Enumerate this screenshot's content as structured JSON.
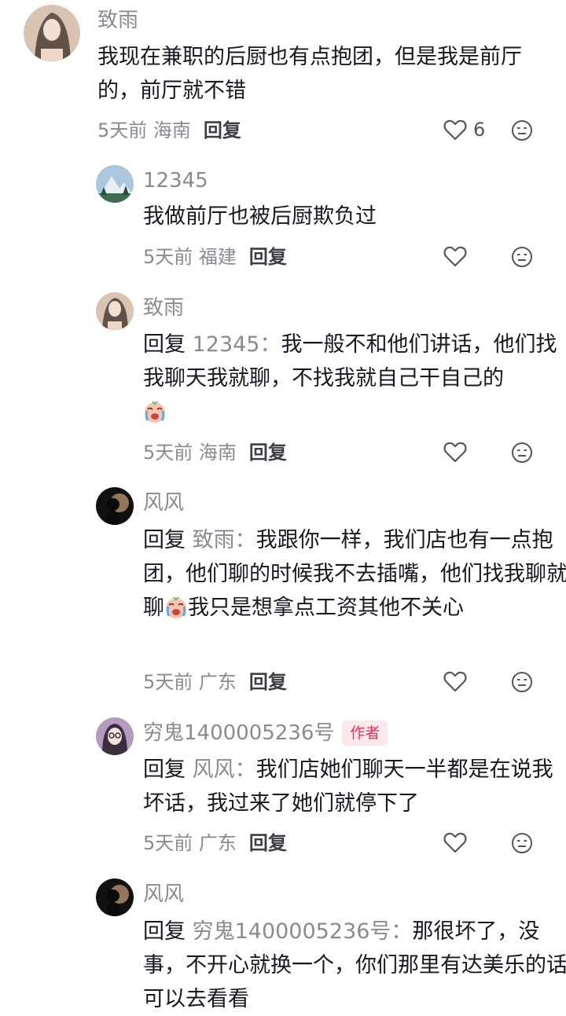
{
  "comments": [
    {
      "user": "致雨",
      "text": "我现在兼职的后厨也有点抱团，但是我是前厅的，前厅就不错",
      "time": "5天前",
      "location": "海南",
      "reply_label": "回复",
      "likes": "6"
    },
    {
      "user": "12345",
      "text": "我做前厅也被后厨欺负过",
      "time": "5天前",
      "location": "福建",
      "reply_label": "回复"
    },
    {
      "user": "致雨",
      "reply_prefix": "回复",
      "reply_target": "12345：",
      "text": "我一般不和他们讲话，他们找我聊天我就聊，不找我就自己干自己的",
      "emoji": "crying-laugh-emoji",
      "time": "5天前",
      "location": "海南",
      "reply_label": "回复"
    },
    {
      "user": "风风",
      "reply_prefix": "回复",
      "reply_target": "致雨：",
      "text_a": "我跟你一样，我们店也有一点抱团，他们聊的时候我不去插嘴，他们找我聊就聊",
      "emoji": "crying-laugh-emoji",
      "text_b": "我只是想拿点工资其他不关心",
      "time": "5天前",
      "location": "广东",
      "reply_label": "回复"
    },
    {
      "user": "穷鬼1400005236号",
      "badge": "作者",
      "reply_prefix": "回复",
      "reply_target": "风风：",
      "text": "我们店她们聊天一半都是在说我坏话，我过来了她们就停下了",
      "time": "5天前",
      "location": "广东",
      "reply_label": "回复"
    },
    {
      "user": "风风",
      "reply_prefix": "回复",
      "reply_target": "穷鬼1400005236号：",
      "text": "那很坏了，没事，不开心就换一个，你们那里有达美乐的话可以去看看"
    }
  ]
}
